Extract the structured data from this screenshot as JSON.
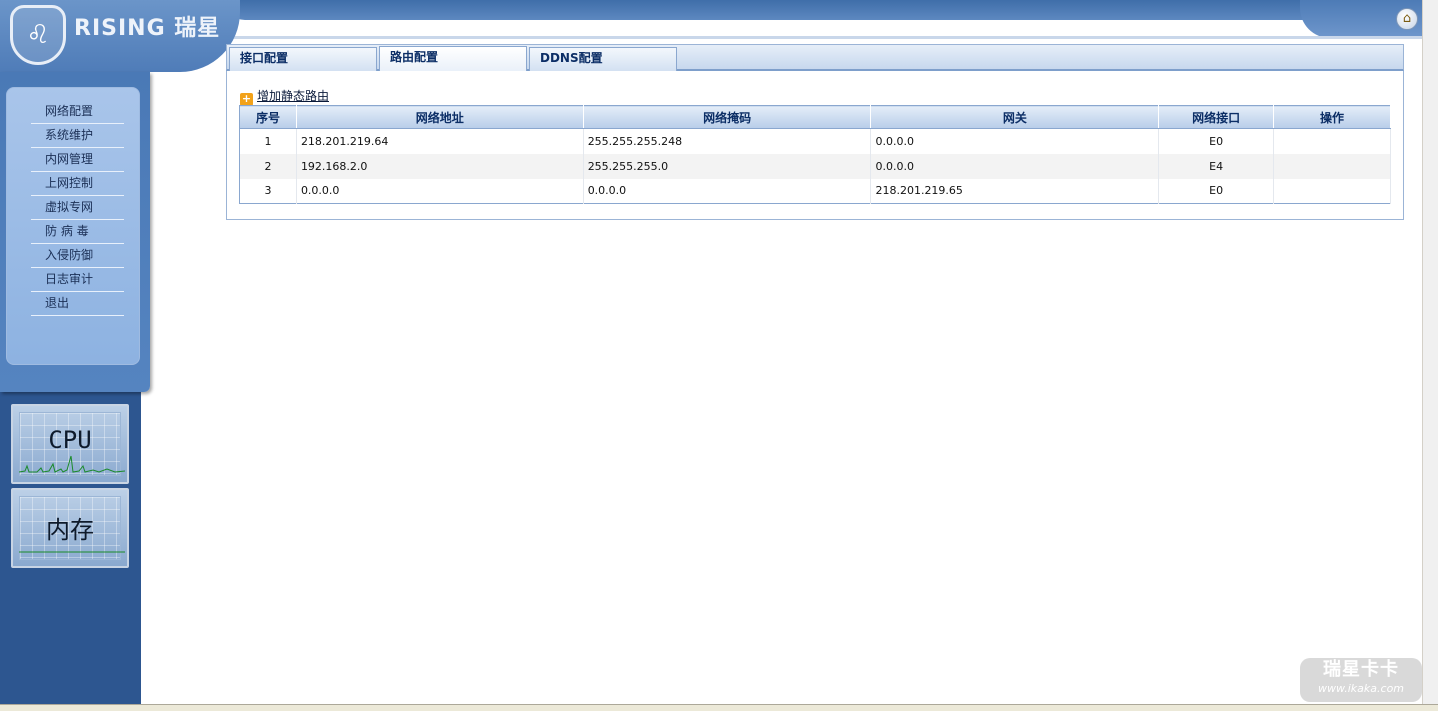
{
  "header": {
    "logo_text": "RISING 瑞星",
    "home_icon": "home-icon"
  },
  "sidebar": {
    "items": [
      {
        "label": "网络配置"
      },
      {
        "label": "系统维护"
      },
      {
        "label": "内网管理"
      },
      {
        "label": "上网控制"
      },
      {
        "label": "虚拟专网"
      },
      {
        "label": "防 病 毒"
      },
      {
        "label": "入侵防御"
      },
      {
        "label": "日志审计"
      },
      {
        "label": "退出"
      }
    ],
    "cpu_label": "CPU",
    "memory_label": "内存"
  },
  "tabs": [
    {
      "label": "接口配置"
    },
    {
      "label": "路由配置"
    },
    {
      "label": "DDNS配置"
    }
  ],
  "active_tab": "路由配置",
  "add_route_label": "增加静态路由",
  "table": {
    "headers": [
      "序号",
      "网络地址",
      "网络掩码",
      "网关",
      "网络接口",
      "操作"
    ],
    "rows": [
      [
        "1",
        "218.201.219.64",
        "255.255.255.248",
        "0.0.0.0",
        "E0",
        ""
      ],
      [
        "2",
        "192.168.2.0",
        "255.255.255.0",
        "0.0.0.0",
        "E4",
        ""
      ],
      [
        "3",
        "0.0.0.0",
        "0.0.0.0",
        "218.201.219.65",
        "E0",
        ""
      ]
    ]
  },
  "watermark": {
    "line1": "瑞星卡卡",
    "line2": "www.ikaka.com"
  },
  "colors": {
    "sidebar_bg": "#2d5690",
    "menu_panel": "#9dbde6",
    "header_text": "#0c2e66"
  }
}
